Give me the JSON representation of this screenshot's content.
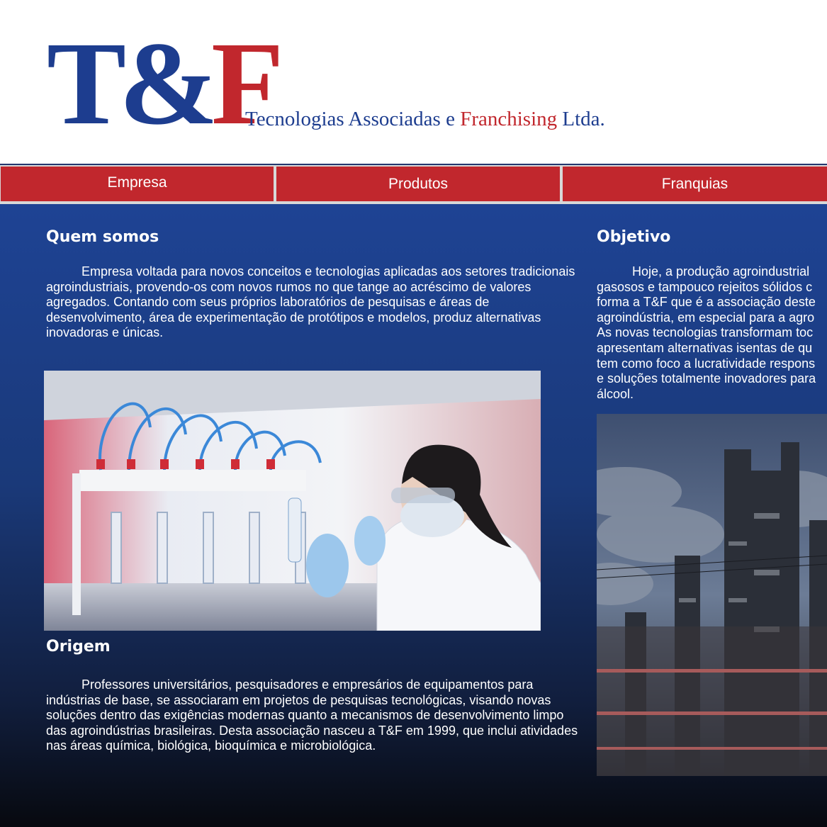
{
  "header": {
    "logo": {
      "letter_t": "T",
      "ampersand": "&",
      "letter_f": "F"
    },
    "tagline": {
      "part1": "Tecnologias Associadas e ",
      "part2": "Franchising",
      "part3": " Ltda."
    }
  },
  "nav": {
    "items": [
      {
        "label": "Empresa"
      },
      {
        "label": "Produtos"
      },
      {
        "label": "Franquias"
      }
    ]
  },
  "sections": {
    "quem_somos": {
      "title": "Quem somos",
      "text": "Empresa voltada para novos conceitos e tecnologias aplicadas aos setores tradicionais agroindustriais, provendo-os com novos rumos no que tange ao acréscimo de valores agregados. Contando com seus próprios  laboratórios de pesquisas e áreas de desenvolvimento, área de experimentação de protótipos e modelos, produz alternativas inovadoras e únicas."
    },
    "origem": {
      "title": "Origem",
      "text": "Professores universitários, pesquisadores e empresários de equipamentos para indústrias de base, se associaram em projetos de pesquisas tecnológicas, visando novas soluções dentro das exigências modernas quanto a mecanismos de desenvolvimento limpo das agroindústrias brasileiras. Desta associação nasceu a T&F em 1999, que inclui atividades nas áreas química, biológica, bioquímica e microbiológica."
    },
    "objetivo": {
      "title": "Objetivo",
      "lines": [
        "Hoje, a produção agroindustrial",
        "gasosos e tampouco rejeitos sólidos c",
        "forma a T&F que é a associação deste",
        "agroindústria, em especial para a agro",
        "As novas tecnologias transformam toc",
        "apresentam alternativas isentas de qu",
        "tem como foco a lucratividade respons",
        "e soluções totalmente inovadores para",
        "álcool."
      ]
    }
  },
  "colors": {
    "brand_blue": "#1d3d8f",
    "brand_red": "#c1272d",
    "nav_red": "#c1272d",
    "content_blue_top": "#1e4394",
    "content_bottom": "#07090f"
  }
}
